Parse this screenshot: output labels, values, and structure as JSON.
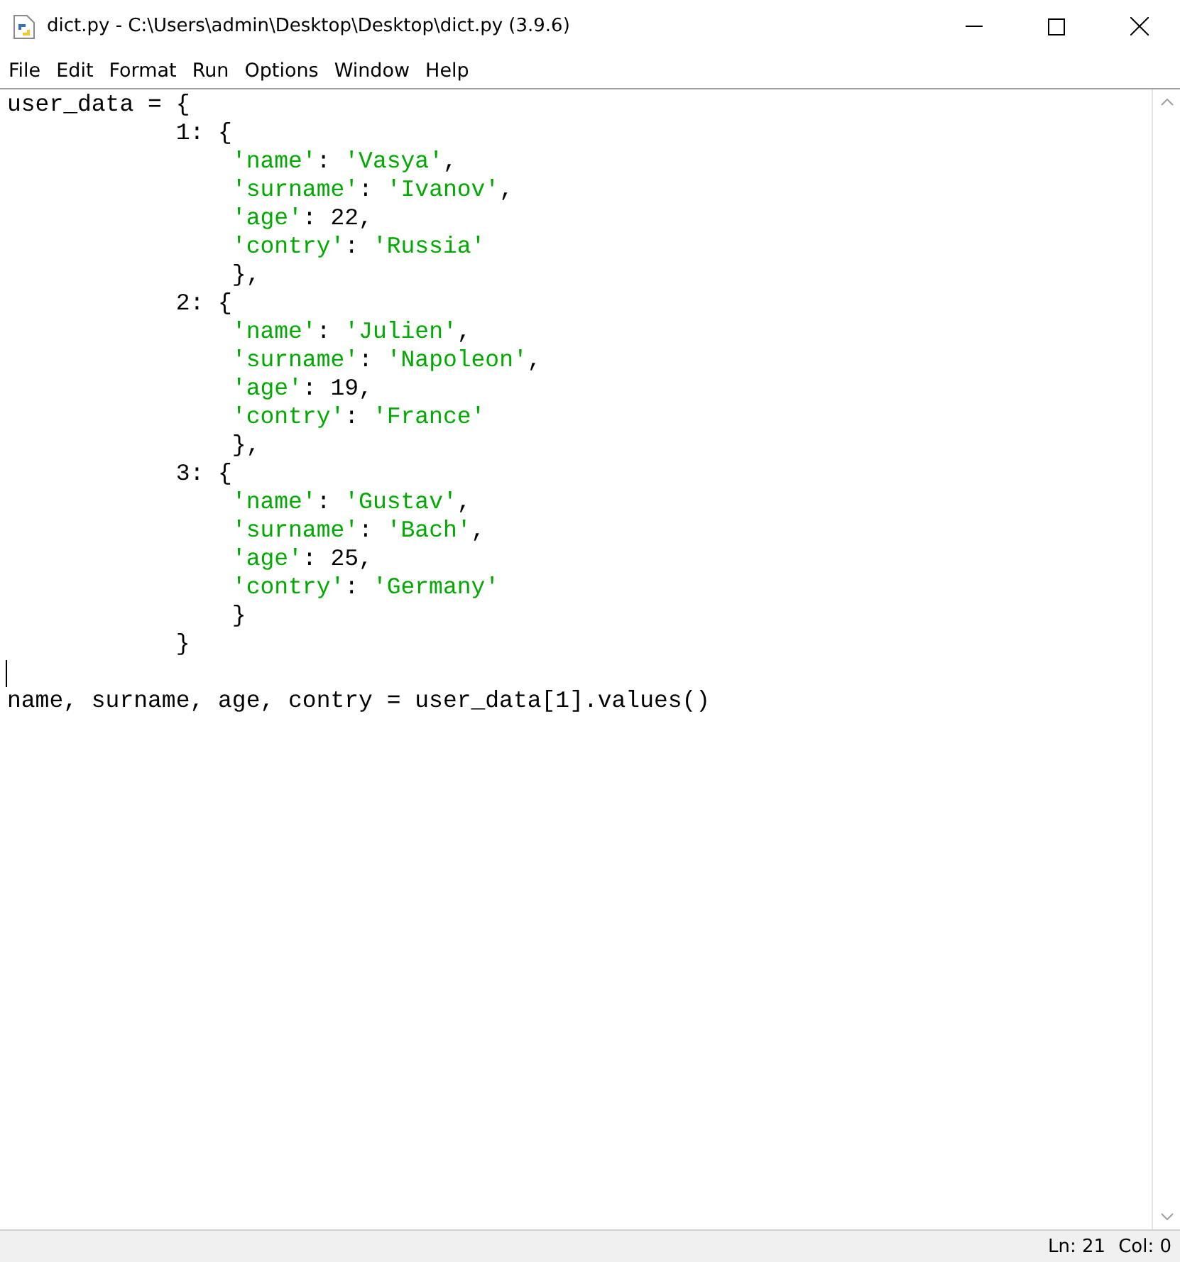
{
  "window": {
    "title": "dict.py - C:\\Users\\admin\\Desktop\\Desktop\\dict.py (3.9.6)"
  },
  "menu": [
    "File",
    "Edit",
    "Format",
    "Run",
    "Options",
    "Window",
    "Help"
  ],
  "editor": {
    "lines": [
      {
        "kind": "code",
        "tokens": [
          {
            "kind": "plain",
            "text": "user_data = {"
          }
        ]
      },
      {
        "kind": "code",
        "tokens": [
          {
            "kind": "plain",
            "text": "            1: {"
          }
        ]
      },
      {
        "kind": "code",
        "tokens": [
          {
            "kind": "string",
            "text": "                'name'"
          },
          {
            "kind": "plain",
            "text": ": "
          },
          {
            "kind": "string",
            "text": "'Vasya'"
          },
          {
            "kind": "plain",
            "text": ","
          }
        ]
      },
      {
        "kind": "code",
        "tokens": [
          {
            "kind": "string",
            "text": "                'surname'"
          },
          {
            "kind": "plain",
            "text": ": "
          },
          {
            "kind": "string",
            "text": "'Ivanov'"
          },
          {
            "kind": "plain",
            "text": ","
          }
        ]
      },
      {
        "kind": "code",
        "tokens": [
          {
            "kind": "string",
            "text": "                'age'"
          },
          {
            "kind": "plain",
            "text": ": 22,"
          }
        ]
      },
      {
        "kind": "code",
        "tokens": [
          {
            "kind": "string",
            "text": "                'contry'"
          },
          {
            "kind": "plain",
            "text": ": "
          },
          {
            "kind": "string",
            "text": "'Russia'"
          }
        ]
      },
      {
        "kind": "code",
        "tokens": [
          {
            "kind": "plain",
            "text": "                },"
          }
        ]
      },
      {
        "kind": "code",
        "tokens": [
          {
            "kind": "plain",
            "text": "            2: {"
          }
        ]
      },
      {
        "kind": "code",
        "tokens": [
          {
            "kind": "string",
            "text": "                'name'"
          },
          {
            "kind": "plain",
            "text": ": "
          },
          {
            "kind": "string",
            "text": "'Julien'"
          },
          {
            "kind": "plain",
            "text": ","
          }
        ]
      },
      {
        "kind": "code",
        "tokens": [
          {
            "kind": "string",
            "text": "                'surname'"
          },
          {
            "kind": "plain",
            "text": ": "
          },
          {
            "kind": "string",
            "text": "'Napoleon'"
          },
          {
            "kind": "plain",
            "text": ","
          }
        ]
      },
      {
        "kind": "code",
        "tokens": [
          {
            "kind": "string",
            "text": "                'age'"
          },
          {
            "kind": "plain",
            "text": ": 19,"
          }
        ]
      },
      {
        "kind": "code",
        "tokens": [
          {
            "kind": "string",
            "text": "                'contry'"
          },
          {
            "kind": "plain",
            "text": ": "
          },
          {
            "kind": "string",
            "text": "'France'"
          }
        ]
      },
      {
        "kind": "code",
        "tokens": [
          {
            "kind": "plain",
            "text": "                },"
          }
        ]
      },
      {
        "kind": "code",
        "tokens": [
          {
            "kind": "plain",
            "text": "            3: {"
          }
        ]
      },
      {
        "kind": "code",
        "tokens": [
          {
            "kind": "string",
            "text": "                'name'"
          },
          {
            "kind": "plain",
            "text": ": "
          },
          {
            "kind": "string",
            "text": "'Gustav'"
          },
          {
            "kind": "plain",
            "text": ","
          }
        ]
      },
      {
        "kind": "code",
        "tokens": [
          {
            "kind": "string",
            "text": "                'surname'"
          },
          {
            "kind": "plain",
            "text": ": "
          },
          {
            "kind": "string",
            "text": "'Bach'"
          },
          {
            "kind": "plain",
            "text": ","
          }
        ]
      },
      {
        "kind": "code",
        "tokens": [
          {
            "kind": "string",
            "text": "                'age'"
          },
          {
            "kind": "plain",
            "text": ": 25,"
          }
        ]
      },
      {
        "kind": "code",
        "tokens": [
          {
            "kind": "string",
            "text": "                'contry'"
          },
          {
            "kind": "plain",
            "text": ": "
          },
          {
            "kind": "string",
            "text": "'Germany'"
          }
        ]
      },
      {
        "kind": "code",
        "tokens": [
          {
            "kind": "plain",
            "text": "                }"
          }
        ]
      },
      {
        "kind": "code",
        "tokens": [
          {
            "kind": "plain",
            "text": "            }"
          }
        ]
      },
      {
        "kind": "cursor"
      },
      {
        "kind": "code",
        "tokens": [
          {
            "kind": "plain",
            "text": "name, surname, age, contry = user_data[1].values()"
          }
        ]
      }
    ]
  },
  "status_bar": {
    "line": "Ln: 21",
    "column": "Col: 0"
  }
}
